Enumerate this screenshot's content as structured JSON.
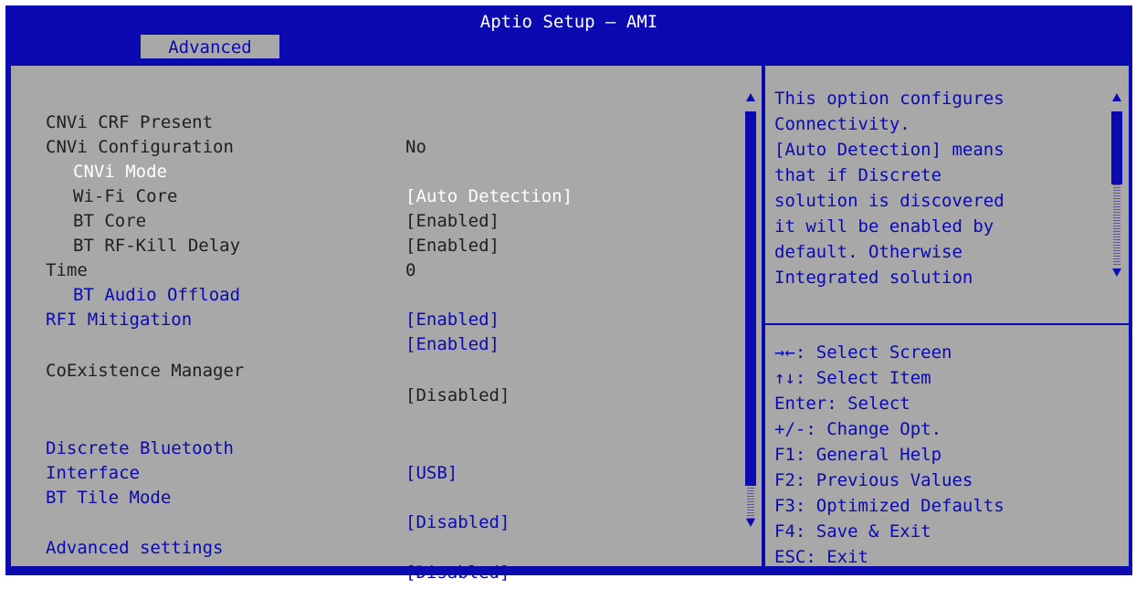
{
  "window": {
    "title": "Aptio Setup – AMI"
  },
  "tabs": [
    {
      "label": "Advanced",
      "active": true
    }
  ],
  "settings": [
    {
      "label": "CNVi CRF Present",
      "value": "No",
      "color": "black",
      "indent": 0
    },
    {
      "label": "CNVi Configuration",
      "value": "",
      "color": "black",
      "indent": 0
    },
    {
      "label": "CNVi Mode",
      "value": "[Auto Detection]",
      "color": "white",
      "indent": 1
    },
    {
      "label": "Wi-Fi Core",
      "value": "[Enabled]",
      "color": "black",
      "indent": 1
    },
    {
      "label": "BT Core",
      "value": "[Enabled]",
      "color": "black",
      "indent": 1
    },
    {
      "label": "BT RF-Kill Delay",
      "label2": "Time",
      "value": "0",
      "color": "black",
      "indent": 1
    },
    {
      "label": "BT Audio Offload",
      "value": "[Enabled]",
      "color": "blue",
      "indent": 1
    },
    {
      "label": "RFI Mitigation",
      "value": "[Enabled]",
      "color": "blue",
      "indent": 0
    },
    {
      "label": "CoExistence Manager",
      "value": "[Disabled]",
      "color": "black",
      "indent": 0
    },
    {
      "label": "Discrete Bluetooth",
      "label2": "Interface",
      "value": "[USB]",
      "color": "blue",
      "indent": 0
    },
    {
      "label": "BT Tile Mode",
      "value": "[Disabled]",
      "color": "blue",
      "indent": 0
    },
    {
      "label": "Advanced settings",
      "value": "[Disabled]",
      "color": "blue",
      "indent": 0
    }
  ],
  "help": {
    "lines": [
      "This option configures",
      "Connectivity.",
      "[Auto Detection] means",
      "that if Discrete",
      "solution is discovered",
      "it will be enabled by",
      "default. Otherwise",
      "Integrated solution"
    ]
  },
  "keys": [
    "→←: Select Screen",
    "↑↓: Select Item",
    "Enter: Select",
    "+/-: Change Opt.",
    "F1: General Help",
    "F2: Previous Values",
    "F3: Optimized Defaults",
    "F4: Save & Exit",
    "ESC: Exit"
  ],
  "colors": {
    "bios_blue": "#0a0ab0",
    "panel_gray": "#a8a8a8",
    "highlight": "#ffffff"
  }
}
